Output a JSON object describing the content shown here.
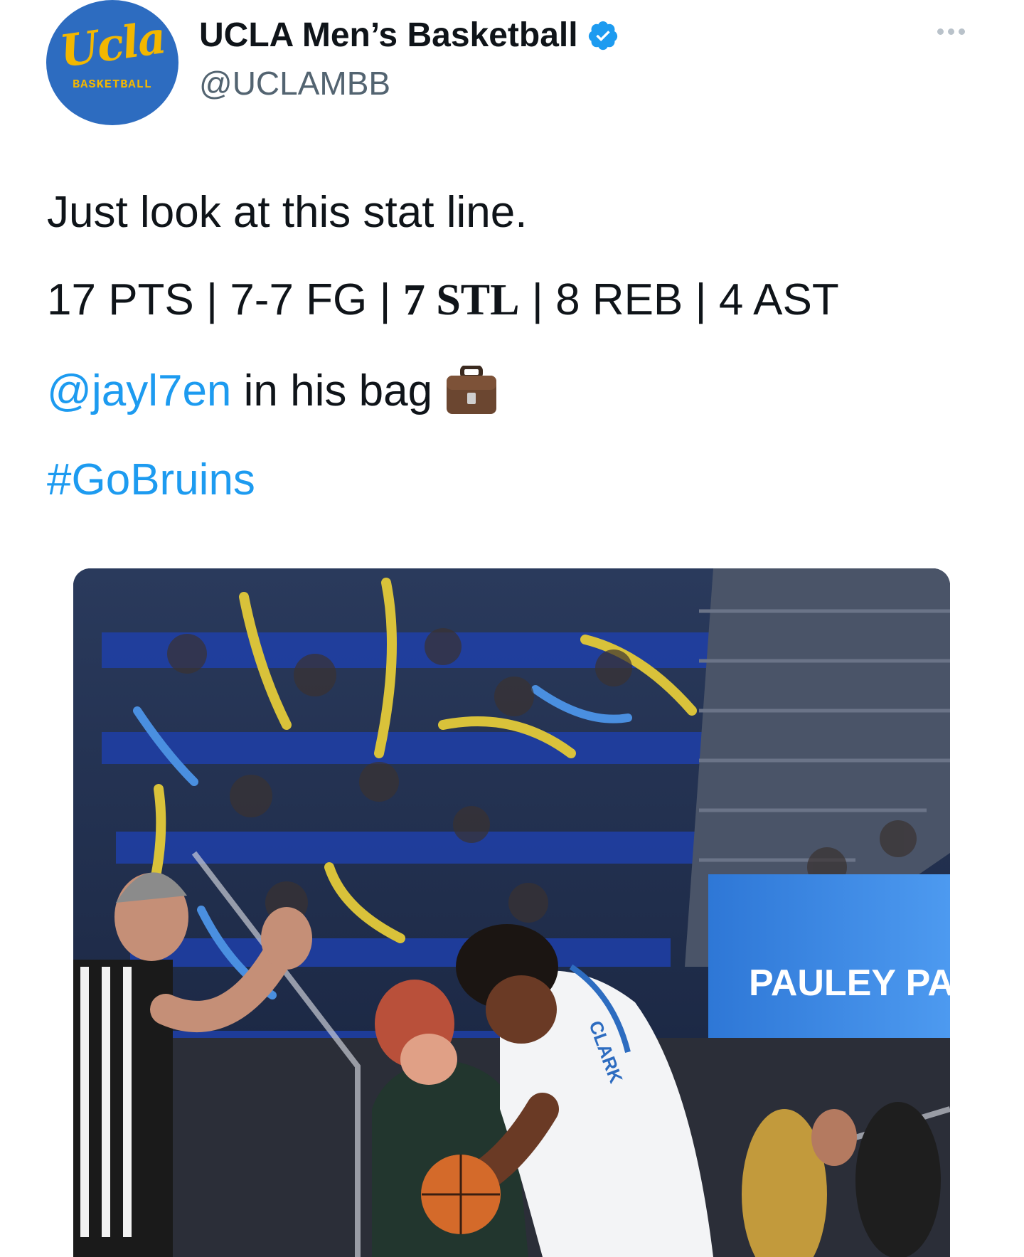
{
  "author": {
    "name": "UCLA Men’s Basketball",
    "handle": "@UCLAMBB",
    "avatar_word": "Ucla",
    "avatar_sub": "BASKETBALL",
    "verified": true
  },
  "tweet": {
    "line1": "Just look at this stat line.",
    "stats": {
      "pts": "17 PTS | 7-7 FG | ",
      "stl": "7 STL",
      "rest": " | 8 REB | 4 AST"
    },
    "mention": "@jayl7en",
    "mention_rest": " in his bag",
    "emoji": "briefcase-icon",
    "hashtag": "#GoBruins"
  },
  "media": {
    "jersey_name": "CLARK",
    "board_text": "PAULEY PA"
  },
  "colors": {
    "link": "#1d9bf0",
    "text": "#0f1419",
    "muted": "#536471",
    "ucla_blue": "#2d6cc0",
    "ucla_gold": "#f2b700"
  }
}
